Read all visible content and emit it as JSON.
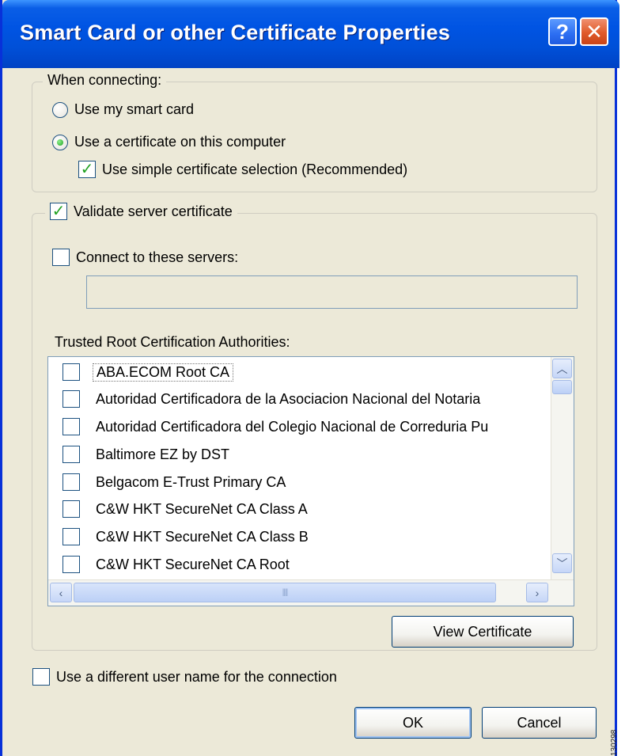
{
  "window": {
    "title": "Smart Card or other Certificate Properties",
    "help_label": "?",
    "close_label": "✕"
  },
  "when_connecting": {
    "label": "When connecting:",
    "use_smart_card": "Use my smart card",
    "use_certificate": "Use a certificate on this computer",
    "simple_selection": "Use simple certificate selection (Recommended)"
  },
  "validate": {
    "label": "Validate server certificate",
    "connect_servers": "Connect to these servers:",
    "servers_value": "",
    "trusted_label": "Trusted Root Certification Authorities:",
    "authorities": [
      "ABA.ECOM Root CA",
      "Autoridad Certificadora de la Asociacion Nacional del Notaria",
      "Autoridad Certificadora del Colegio Nacional de Correduria Pu",
      "Baltimore EZ by DST",
      "Belgacom E-Trust Primary CA",
      "C&W HKT SecureNet CA Class A",
      "C&W HKT SecureNet CA Class B",
      "C&W HKT SecureNet CA Root"
    ],
    "view_certificate": "View Certificate"
  },
  "different_user": "Use a different user name for the connection",
  "buttons": {
    "ok": "OK",
    "cancel": "Cancel"
  },
  "watermark": "130298",
  "colors": {
    "titlebar": "#0054e3",
    "dialog_bg": "#ece9d8",
    "check": "#21a121"
  }
}
